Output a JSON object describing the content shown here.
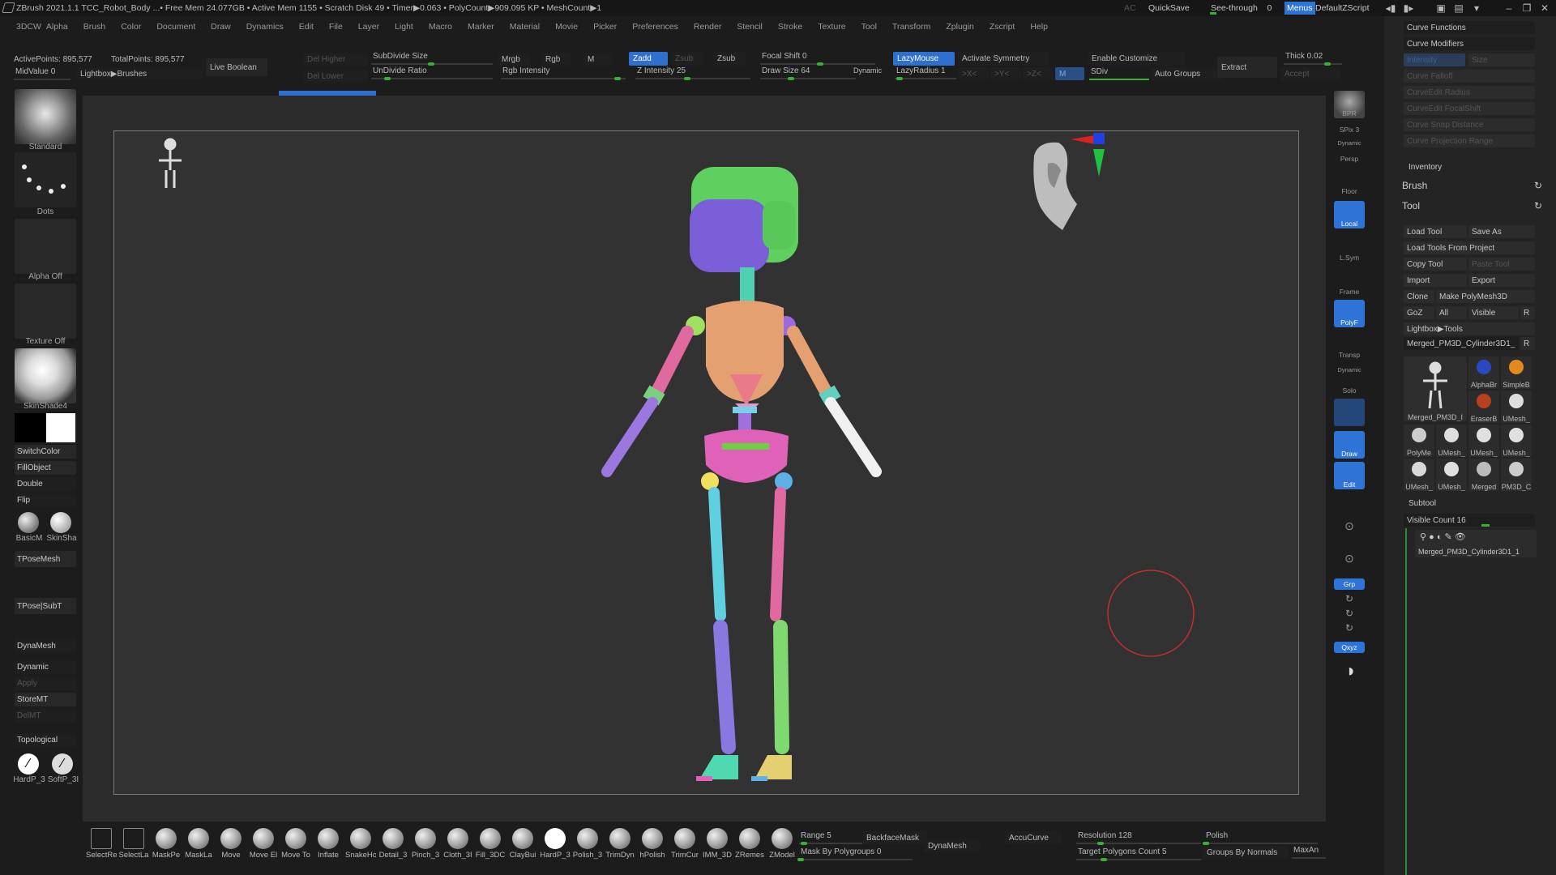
{
  "titlebar": {
    "title": "ZBrush 2021.1.1    TCC_Robot_Body    ...• Free Mem 24.077GB • Active Mem 1155 • Scratch Disk 49 •  Timer▶0.063 • PolyCount▶909.095 KP  • MeshCount▶1",
    "ac": "AC",
    "quicksave": "QuickSave",
    "seethrough": "See-through",
    "seethrough_value": "0",
    "menus": "Menus",
    "defaultzscript": "DefaultZScript"
  },
  "menubar": [
    "3DCW",
    "Alpha",
    "Brush",
    "Color",
    "Document",
    "Draw",
    "Dynamics",
    "Edit",
    "File",
    "Layer",
    "Light",
    "Macro",
    "Marker",
    "Material",
    "Movie",
    "Picker",
    "Preferences",
    "Render",
    "Stencil",
    "Stroke",
    "Texture",
    "Tool",
    "Transform",
    "Zplugin",
    "Zscript",
    "Help"
  ],
  "topbar": {
    "active_points": "ActivePoints: 895,577",
    "total_points": "TotalPoints: 895,577",
    "midvalue": "MidValue 0",
    "lightbox_brushes": "Lightbox▶Brushes",
    "live_boolean": "Live Boolean",
    "del_higher": "Del Higher",
    "del_lower": "Del Lower",
    "subdivide_size": "SubDivide Size",
    "undivide_ratio": "UnDivide Ratio",
    "mrgb": "Mrgb",
    "rgb": "Rgb",
    "m": "M",
    "rgb_intensity": "Rgb Intensity",
    "zadd": "Zadd",
    "zsub_off": "Zsub",
    "zsub": "Zsub",
    "z_intensity": "Z Intensity 25",
    "focal_shift": "Focal Shift 0",
    "draw_size": "Draw Size 64",
    "dynamic": "Dynamic",
    "lazymouse": "LazyMouse",
    "lazyradius": "LazyRadius 1",
    "activate_symmetry": "Activate Symmetry",
    "sym_x": ">X<",
    "sym_y": ">Y<",
    "sym_z": ">Z<",
    "sym_m": "M",
    "sdiv": "SDiv",
    "enable_customize": "Enable Customize",
    "auto_groups": "Auto Groups",
    "extract": "Extract",
    "accept": "Accept",
    "thick": "Thick 0.02"
  },
  "leftshelf": {
    "brush": "Standard",
    "stroke": "Dots",
    "alpha": "Alpha Off",
    "texture": "Texture Off",
    "material": "SkinShade4",
    "switchcolor": "SwitchColor",
    "fillobject": "FillObject",
    "double": "Double",
    "flip": "Flip",
    "mat1": "BasicM",
    "mat2": "SkinSha",
    "tposemesh": "TPoseMesh",
    "tpose_subt": "TPose|SubT",
    "dynamesh": "DynaMesh",
    "dynamic": "Dynamic",
    "apply": "Apply",
    "storemt": "StoreMT",
    "delmt": "DelMT",
    "topological": "Topological",
    "brushA": "HardP_3",
    "brushB": "SoftP_3I"
  },
  "rightshelf": {
    "bpr": "BPR",
    "spix": "SPix 3",
    "dynamic": "Dynamic",
    "persp": "Persp",
    "floor": "Floor",
    "local": "Local",
    "lsym": "L.Sym",
    "frame": "Frame",
    "polyf": "PolyF",
    "transp": "Transp",
    "dynamic2": "Dynamic",
    "solo": "Solo",
    "draw": "Draw",
    "edit": "Edit",
    "grp": "Grp",
    "xyz": "Qxyz"
  },
  "rpanel": {
    "curve_functions": "Curve Functions",
    "curve_modifiers": "Curve Modifiers",
    "intensity": "Intensity",
    "size": "Size",
    "curve_falloff": "Curve Falloff",
    "curve_edit_radius": "CurveEdit Radius",
    "curve_edit_focalshift": "CurveEdit FocalShift",
    "curve_snap_distance": "Curve Snap Distance",
    "curve_projection_range": "Curve Projection Range",
    "inventory": "Inventory",
    "brush": "Brush",
    "tool": "Tool",
    "load_tool": "Load Tool",
    "save_as": "Save As",
    "load_tools_from_project": "Load Tools From Project",
    "copy_tool": "Copy Tool",
    "paste_tool": "Paste Tool",
    "import": "Import",
    "export": "Export",
    "clone": "Clone",
    "make_polymesh": "Make PolyMesh3D",
    "goz": "GoZ",
    "all": "All",
    "visible": "Visible",
    "r": "R",
    "lightbox_tools": "Lightbox▶Tools",
    "current_tool": "Merged_PM3D_Cylinder3D1_",
    "r2": "R",
    "thumbs": [
      {
        "name": "AlphaBr"
      },
      {
        "name": "SimpleB"
      },
      {
        "name": "EraserB"
      },
      {
        "name": "UMesh_"
      },
      {
        "name": "PolyMe"
      },
      {
        "name": "UMesh_"
      },
      {
        "name": "UMesh_"
      },
      {
        "name": "UMesh_"
      },
      {
        "name": "UMesh_"
      },
      {
        "name": "UMesh_"
      },
      {
        "name": "Merged"
      },
      {
        "name": "PM3D_C"
      }
    ],
    "main_thumb": "Merged_PM3D_I",
    "subtool": "Subtool",
    "visible_count": "Visible Count 16",
    "subtool_item": "Merged_PM3D_Cylinder3D1_1"
  },
  "bottombar": {
    "tools": [
      "SelectRe",
      "SelectLa",
      "MaskPe",
      "MaskLa",
      "Move",
      "Move El",
      "Move To",
      "Inflate",
      "SnakeHo",
      "Detail_3",
      "Pinch_3",
      "Cloth_3I",
      "Fill_3DC",
      "ClayBui",
      "HardP_3",
      "Polish_3",
      "TrimDyn",
      "hPolish",
      "TrimCur",
      "IMM_3D",
      "ZRemes",
      "ZModel"
    ],
    "range": "Range 5",
    "backfacemask": "BackfaceMask",
    "mask_by_polygroups": "Mask By Polygroups 0",
    "dynamesh": "DynaMesh",
    "accucurve": "AccuCurve",
    "resolution": "Resolution 128",
    "target_polygons": "Target Polygons Count 5",
    "polish": "Polish",
    "groups_by_normals": "Groups By Normals",
    "maxan": "MaxAn"
  },
  "colors": {
    "accent_blue": "#2e73d6",
    "slider_green": "#38b038",
    "viewport_bg": "#323232"
  }
}
